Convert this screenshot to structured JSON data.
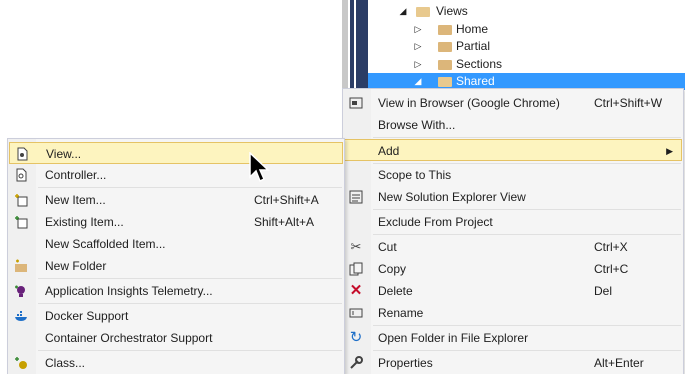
{
  "tree": {
    "items": [
      {
        "label": "Views",
        "expander": "◢",
        "open": true
      },
      {
        "label": "Home",
        "expander": "▷"
      },
      {
        "label": "Partial",
        "expander": "▷"
      },
      {
        "label": "Sections",
        "expander": "▷"
      },
      {
        "label": "Shared",
        "expander": "◢",
        "open": true,
        "selected": true
      }
    ]
  },
  "main_menu": {
    "items": [
      {
        "label": "View in Browser (Google Chrome)",
        "shortcut": "Ctrl+Shift+W",
        "icon": "browser-icon"
      },
      {
        "label": "Browse With...",
        "shortcut": "",
        "icon": ""
      },
      {
        "label": "Add",
        "shortcut": "",
        "icon": "",
        "submenu_arrow": "▶"
      },
      {
        "label": "Scope to This",
        "shortcut": "",
        "icon": ""
      },
      {
        "label": "New Solution Explorer View",
        "shortcut": "",
        "icon": "solution-view-icon"
      },
      {
        "label": "Exclude From Project",
        "shortcut": "",
        "icon": ""
      },
      {
        "label": "Cut",
        "shortcut": "Ctrl+X",
        "icon": "scissors-icon"
      },
      {
        "label": "Copy",
        "shortcut": "Ctrl+C",
        "icon": "copy-icon"
      },
      {
        "label": "Delete",
        "shortcut": "Del",
        "icon": "delete-icon"
      },
      {
        "label": "Rename",
        "shortcut": "",
        "icon": "rename-icon"
      },
      {
        "label": "Open Folder in File Explorer",
        "shortcut": "",
        "icon": "refresh-icon"
      },
      {
        "label": "Properties",
        "shortcut": "Alt+Enter",
        "icon": "wrench-icon"
      }
    ]
  },
  "add_menu": {
    "items": [
      {
        "label": "View...",
        "shortcut": "",
        "icon": "view-file-icon"
      },
      {
        "label": "Controller...",
        "shortcut": "",
        "icon": "controller-file-icon"
      },
      {
        "label": "New Item...",
        "shortcut": "Ctrl+Shift+A",
        "icon": "new-item-icon"
      },
      {
        "label": "Existing Item...",
        "shortcut": "Shift+Alt+A",
        "icon": "existing-item-icon"
      },
      {
        "label": "New Scaffolded Item...",
        "shortcut": "",
        "icon": ""
      },
      {
        "label": "New Folder",
        "shortcut": "",
        "icon": "new-folder-icon"
      },
      {
        "label": "Application Insights Telemetry...",
        "shortcut": "",
        "icon": "insights-icon"
      },
      {
        "label": "Docker Support",
        "shortcut": "",
        "icon": "docker-icon"
      },
      {
        "label": "Container Orchestrator Support",
        "shortcut": "",
        "icon": ""
      },
      {
        "label": "Class...",
        "shortcut": "",
        "icon": "class-icon"
      }
    ]
  },
  "colors": {
    "highlight_bg": "#fdf4bf",
    "highlight_border": "#e5c365",
    "selection": "#3399ff",
    "menu_bg": "#f5f5f5"
  }
}
